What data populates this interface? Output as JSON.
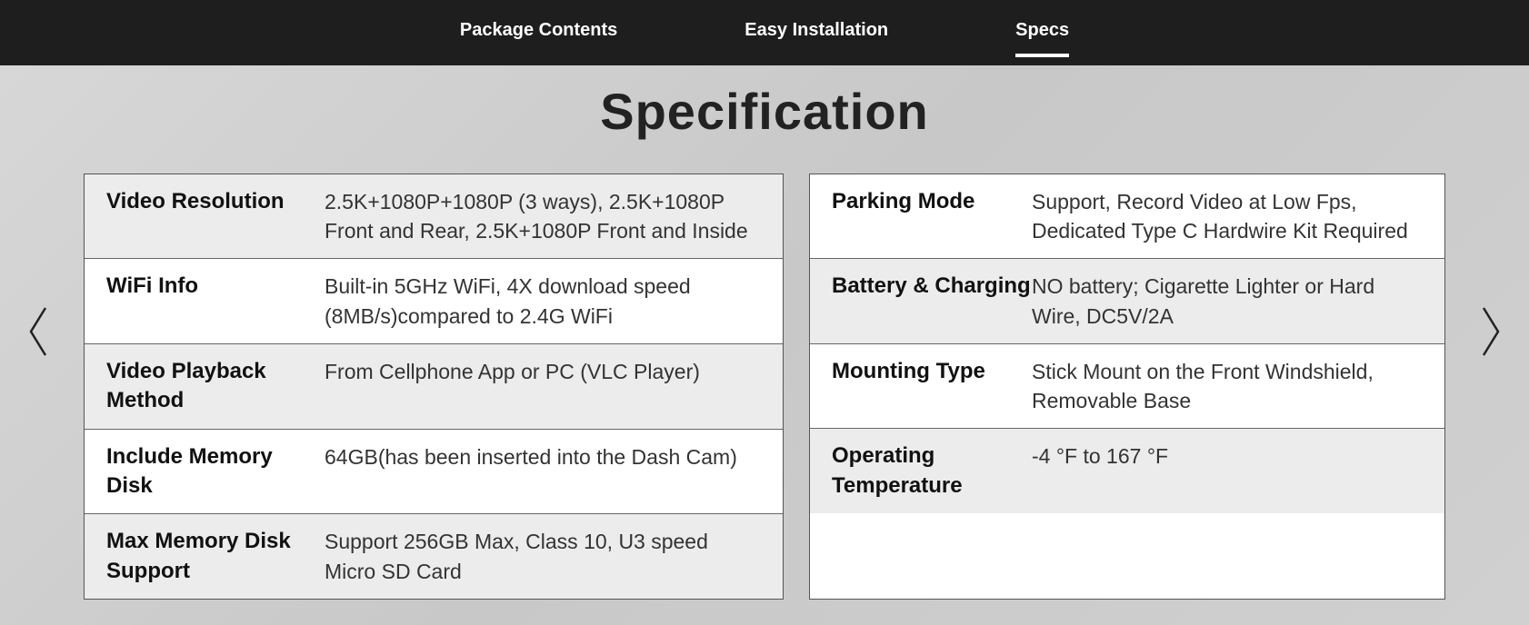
{
  "nav": {
    "items": [
      {
        "label": "Package Contents",
        "active": false
      },
      {
        "label": "Easy Installation",
        "active": false
      },
      {
        "label": "Specs",
        "active": true
      }
    ]
  },
  "title": "Specification",
  "leftTable": [
    {
      "label": "Video Resolution",
      "value": "2.5K+1080P+1080P (3 ways), 2.5K+1080P Front and Rear, 2.5K+1080P Front and Inside",
      "shaded": true
    },
    {
      "label": "WiFi Info",
      "value": "Built-in 5GHz WiFi, 4X download speed (8MB/s)compared to 2.4G WiFi",
      "shaded": false
    },
    {
      "label": "Video Playback Method",
      "value": "From Cellphone App or PC (VLC Player)",
      "shaded": true
    },
    {
      "label": "Include Memory Disk",
      "value": "64GB(has been inserted into the Dash Cam)",
      "shaded": false
    },
    {
      "label": "Max Memory Disk Support",
      "value": "Support 256GB Max, Class 10, U3 speed Micro SD Card",
      "shaded": true
    }
  ],
  "rightTable": [
    {
      "label": "Parking Mode",
      "value": "Support, Record Video at Low Fps, Dedicated Type C Hardwire Kit Required",
      "shaded": false
    },
    {
      "label": "Battery & Charging",
      "value": "NO battery; Cigarette Lighter or Hard Wire, DC5V/2A",
      "shaded": true
    },
    {
      "label": "Mounting Type",
      "value": "Stick Mount on the Front Windshield, Removable Base",
      "shaded": false
    },
    {
      "label": "Operating Temperature",
      "value": "-4 °F to 167 °F",
      "shaded": true
    }
  ]
}
